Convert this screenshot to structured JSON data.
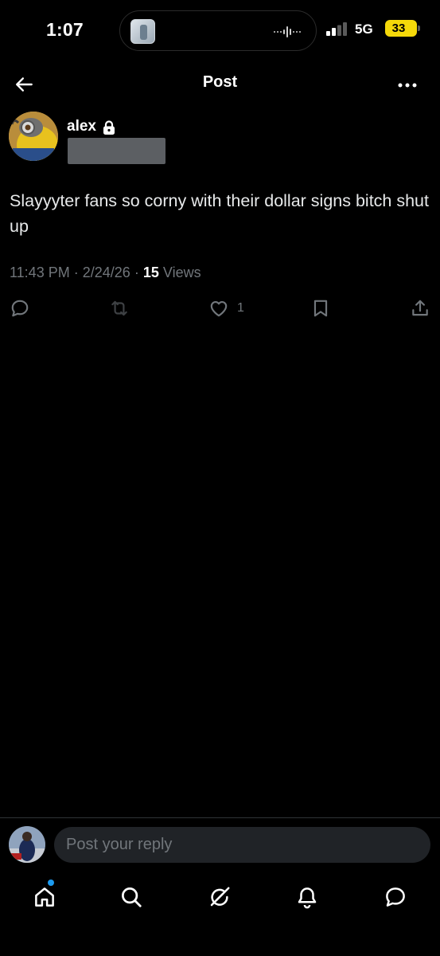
{
  "status_bar": {
    "time": "1:07",
    "network": "5G",
    "battery": "33",
    "battery_color": "#f5d90a",
    "signal_bars": 2
  },
  "nav": {
    "title": "Post",
    "back_icon": "arrow-left-icon",
    "more_icon": "more-horizontal-icon"
  },
  "post": {
    "author": {
      "display_name": "alex",
      "protected_icon": "lock-icon"
    },
    "text": "Slayyyter fans so corny with their dollar signs bitch shut up",
    "time": "11:43 PM",
    "date": "2/24/26",
    "separator": "·",
    "views_count": "15",
    "views_label": "Views",
    "actions": {
      "reply_icon": "reply-icon",
      "repost_icon": "repost-icon",
      "like_icon": "heart-icon",
      "like_count": "1",
      "bookmark_icon": "bookmark-icon",
      "share_icon": "share-icon"
    }
  },
  "reply": {
    "placeholder": "Post your reply"
  },
  "tabbar": {
    "items": [
      {
        "name": "home",
        "icon": "home-icon",
        "active": true,
        "has_notification": true
      },
      {
        "name": "search",
        "icon": "search-icon"
      },
      {
        "name": "grok",
        "icon": "grok-icon"
      },
      {
        "name": "notifications",
        "icon": "bell-icon"
      },
      {
        "name": "messages",
        "icon": "message-icon"
      }
    ]
  },
  "colors": {
    "background": "#000000",
    "text_primary": "#e7e9ea",
    "text_secondary": "#71767b",
    "accent": "#1d9bf0",
    "disabled_icon": "#3e4144"
  }
}
